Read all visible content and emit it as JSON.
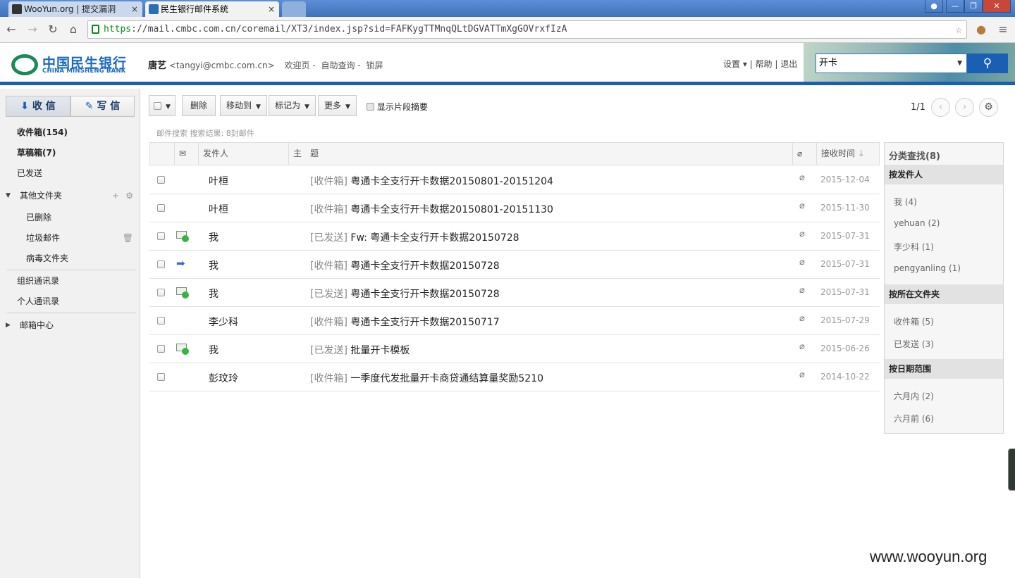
{
  "browser": {
    "tabs": [
      {
        "title": "WooYun.org | 提交漏洞",
        "close": "×"
      },
      {
        "title": "民生银行邮件系统",
        "close": "×"
      }
    ],
    "url_scheme": "https",
    "url_rest": "://mail.cmbc.com.cn/coremail/XT3/index.jsp?sid=FAFKygTTMnqQLtDGVATTmXgGOVrxfIzA"
  },
  "header": {
    "logo_cn": "中国民生银行",
    "logo_en": "CHINA MINSHENG BANK",
    "user_name": "唐艺",
    "user_email": "<tangyi@cmbc.com.cn>",
    "links": [
      "欢迎页",
      "自助查询",
      "锁屏"
    ],
    "settings": "设置",
    "help": "帮助",
    "logout": "退出",
    "search_value": "开卡"
  },
  "sidebar": {
    "receive": "收 信",
    "write": "写 信",
    "inbox": "收件箱(154)",
    "drafts": "草稿箱(7)",
    "sent": "已发送",
    "other_folders": "其他文件夹",
    "deleted": "已删除",
    "spam": "垃圾邮件",
    "virus": "病毒文件夹",
    "org_contacts": "组织通讯录",
    "personal_contacts": "个人通讯录",
    "mailbox_center": "邮箱中心"
  },
  "toolbar": {
    "delete": "删除",
    "move_to": "移动到",
    "mark_as": "标记为",
    "more": "更多",
    "show_summary": "显示片段摘要",
    "pager": "1/1"
  },
  "search_summary": "邮件搜索  搜索结果: 8封邮件",
  "table": {
    "col_sender": "发件人",
    "col_subject": "主　题",
    "col_time": "接收时间",
    "rows": [
      {
        "status": "none",
        "sender": "叶桓",
        "folder": "[收件箱]",
        "subject": "粤通卡全支行开卡数据20150801-20151204",
        "date": "2015-12-04"
      },
      {
        "status": "none",
        "sender": "叶桓",
        "folder": "[收件箱]",
        "subject": "粤通卡全支行开卡数据20150801-20151130",
        "date": "2015-11-30"
      },
      {
        "status": "sent",
        "sender": "我",
        "folder": "[已发送]",
        "subject": "Fw: 粤通卡全支行开卡数据20150728",
        "date": "2015-07-31"
      },
      {
        "status": "forward",
        "sender": "我",
        "folder": "[收件箱]",
        "subject": "粤通卡全支行开卡数据20150728",
        "date": "2015-07-31"
      },
      {
        "status": "sent",
        "sender": "我",
        "folder": "[已发送]",
        "subject": "粤通卡全支行开卡数据20150728",
        "date": "2015-07-31"
      },
      {
        "status": "none",
        "sender": "李少科",
        "folder": "[收件箱]",
        "subject": "粤通卡全支行开卡数据20150717",
        "date": "2015-07-29"
      },
      {
        "status": "sent",
        "sender": "我",
        "folder": "[已发送]",
        "subject": "批量开卡模板",
        "date": "2015-06-26"
      },
      {
        "status": "none",
        "sender": "彭玟玲",
        "folder": "[收件箱]",
        "subject": "一季度代发批量开卡商贷通结算量奖励5210",
        "date": "2014-10-22"
      }
    ]
  },
  "categories": {
    "title": "分类查找(8)",
    "by_sender": "按发件人",
    "senders": [
      "我 (4)",
      "yehuan (2)",
      "李少科 (1)",
      "pengyanling (1)"
    ],
    "by_folder": "按所在文件夹",
    "folders": [
      "收件箱 (5)",
      "已发送 (3)"
    ],
    "by_date": "按日期范围",
    "dates": [
      "六月内 (2)",
      "六月前 (6)"
    ]
  },
  "watermark": "www.wooyun.org"
}
